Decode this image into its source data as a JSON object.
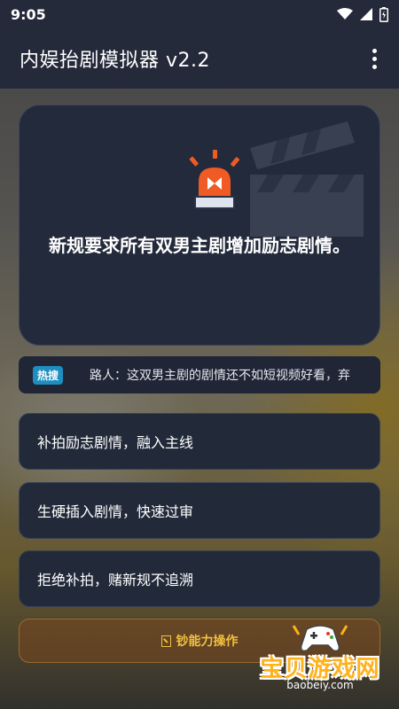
{
  "status": {
    "time": "9:05"
  },
  "app": {
    "title": "内娱抬剧模拟器 v2.2"
  },
  "event": {
    "text": "新规要求所有双男主剧增加励志剧情。"
  },
  "hot": {
    "badge": "热搜",
    "text": "路人：这双男主剧的剧情还不如短视频好看，弃"
  },
  "options": [
    {
      "label": "补拍励志剧情，融入主线"
    },
    {
      "label": "生硬插入剧情，快速过审"
    },
    {
      "label": "拒绝补拍，赌新规不追溯"
    }
  ],
  "ability": {
    "label": "钞能力操作"
  },
  "watermark": {
    "name": "宝贝游戏网",
    "url": "baobeiy.com"
  },
  "colors": {
    "appbar": "#252a3a",
    "card": "#232a3b",
    "hot_badge": "#1e8dbf",
    "ability_text": "#f0c040",
    "siren": "#f05a24"
  }
}
